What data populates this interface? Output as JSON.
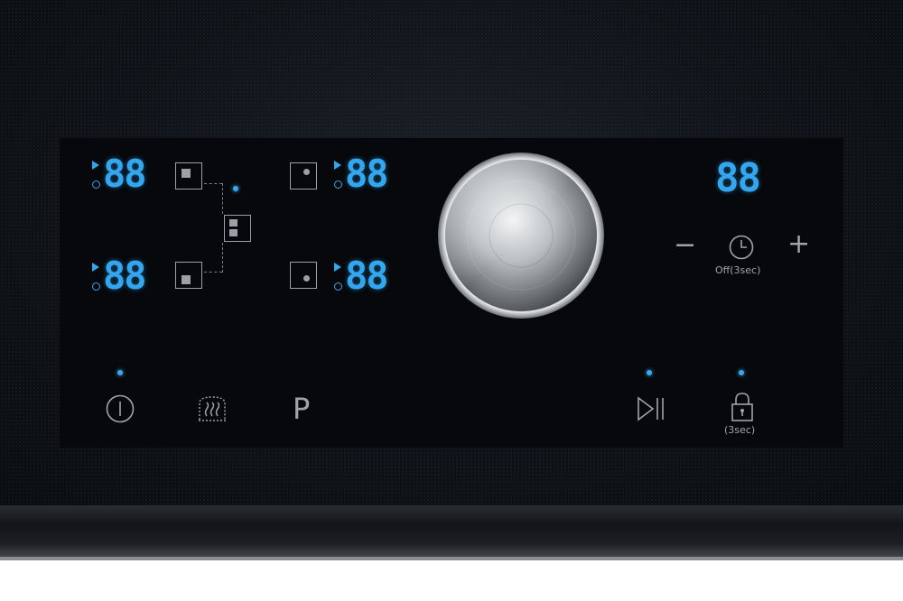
{
  "displays": {
    "zone_front_left": "88",
    "zone_rear_left": "88",
    "zone_front_right": "88",
    "zone_rear_right": "88",
    "timer": "88"
  },
  "timer_controls": {
    "minus_label": "−",
    "plus_label": "+",
    "off_label": "Off(3sec)"
  },
  "bottom_controls": {
    "pause_label": "P",
    "lock_label": "(3sec)"
  },
  "colors": {
    "display": "#33a6f0",
    "indicator": "#3aa8f0",
    "icon": "#a0a4a8",
    "panel": "#06080b"
  },
  "icons": [
    "play-arrow-icon",
    "clock-icon",
    "zone-square-icon",
    "bridge-zone-icon",
    "power-icon",
    "keep-warm-icon",
    "play-pause-icon",
    "lock-icon",
    "knob"
  ]
}
